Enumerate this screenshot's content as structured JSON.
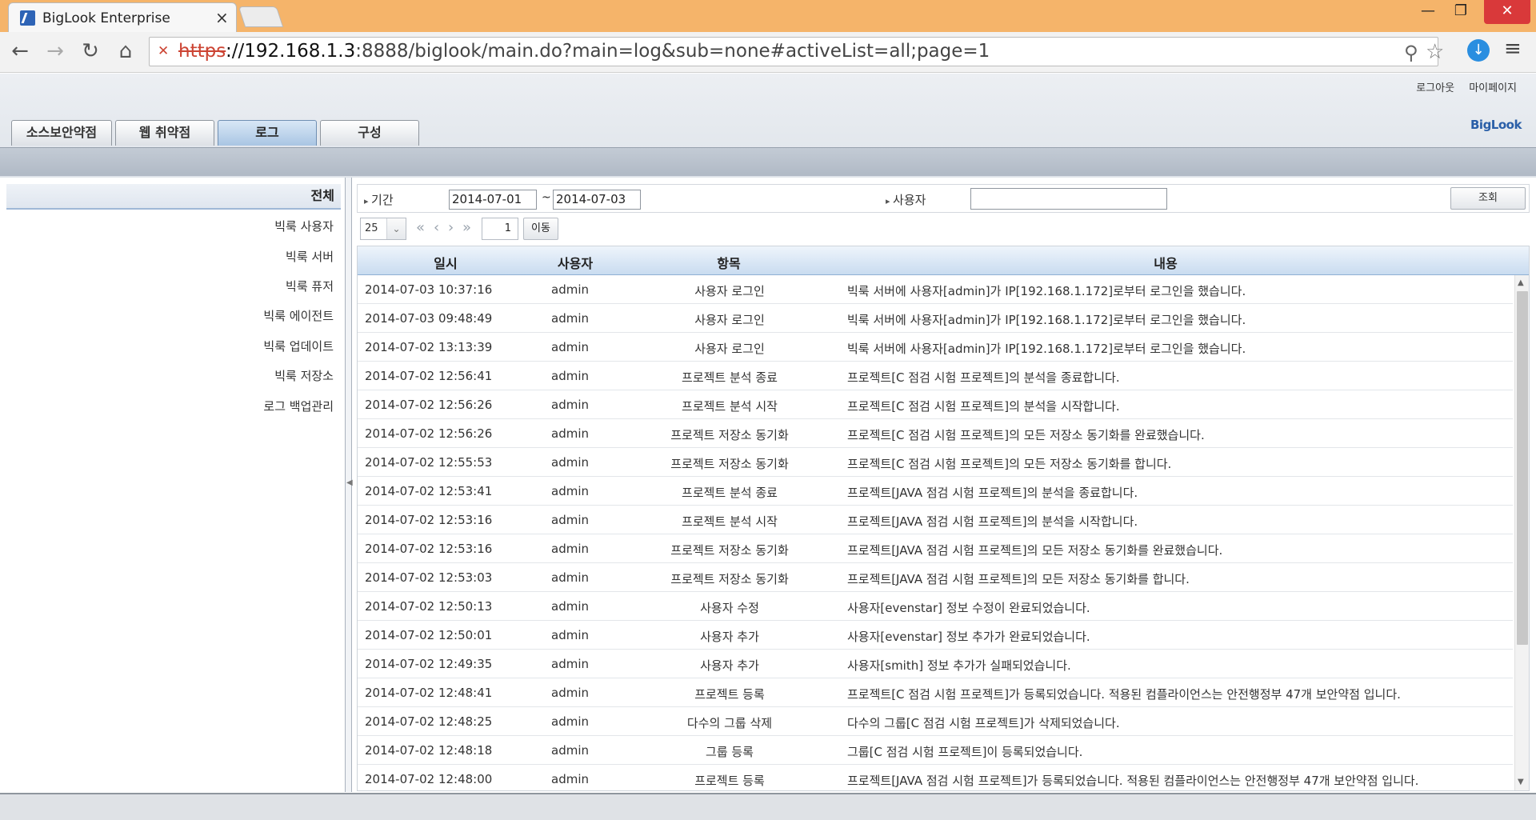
{
  "browser": {
    "tab_title": "BigLook Enterprise",
    "tab_close": "×",
    "url_scheme": "https",
    "url_host": "://192.168.1.3",
    "url_rest": ":8888/biglook/main.do?main=log&sub=none#activeList=all;page=1",
    "window_min": "—",
    "window_max": "❐",
    "window_close": "✕"
  },
  "header": {
    "logout": "로그아웃",
    "mypage": "마이페이지",
    "brand": "BigLook",
    "tabs": [
      {
        "label": "소스보안약점",
        "active": false
      },
      {
        "label": "웹 취약점",
        "active": false
      },
      {
        "label": "로그",
        "active": true
      },
      {
        "label": "구성",
        "active": false
      }
    ]
  },
  "sidebar": {
    "title": "전체",
    "items": [
      "빅룩 사용자",
      "빅룩 서버",
      "빅룩 퓨저",
      "빅룩 에이전트",
      "빅룩 업데이트",
      "빅룩 저장소",
      "로그 백업관리"
    ]
  },
  "filter": {
    "period_label": "기간",
    "date_from": "2014-07-01",
    "tilde": "~",
    "date_to": "2014-07-03",
    "user_label": "사용자",
    "user_value": "",
    "search_button": "조회"
  },
  "pager": {
    "page_size": "25",
    "page": "1",
    "go_button": "이동"
  },
  "grid": {
    "columns": [
      "일시",
      "사용자",
      "항목",
      "내용"
    ],
    "rows": [
      {
        "date": "2014-07-03 10:37:16",
        "user": "admin",
        "item": "사용자 로그인",
        "msg": "빅룩 서버에 사용자[admin]가 IP[192.168.1.172]로부터 로그인을 했습니다."
      },
      {
        "date": "2014-07-03 09:48:49",
        "user": "admin",
        "item": "사용자 로그인",
        "msg": "빅룩 서버에 사용자[admin]가 IP[192.168.1.172]로부터 로그인을 했습니다."
      },
      {
        "date": "2014-07-02 13:13:39",
        "user": "admin",
        "item": "사용자 로그인",
        "msg": "빅룩 서버에 사용자[admin]가 IP[192.168.1.172]로부터 로그인을 했습니다."
      },
      {
        "date": "2014-07-02 12:56:41",
        "user": "admin",
        "item": "프로젝트 분석 종료",
        "msg": "프로젝트[C 점검 시험 프로젝트]의 분석을 종료합니다."
      },
      {
        "date": "2014-07-02 12:56:26",
        "user": "admin",
        "item": "프로젝트 분석 시작",
        "msg": "프로젝트[C 점검 시험 프로젝트]의 분석을 시작합니다."
      },
      {
        "date": "2014-07-02 12:56:26",
        "user": "admin",
        "item": "프로젝트 저장소 동기화",
        "msg": "프로젝트[C 점검 시험 프로젝트]의 모든 저장소 동기화를 완료했습니다."
      },
      {
        "date": "2014-07-02 12:55:53",
        "user": "admin",
        "item": "프로젝트 저장소 동기화",
        "msg": "프로젝트[C 점검 시험 프로젝트]의 모든 저장소 동기화를 합니다."
      },
      {
        "date": "2014-07-02 12:53:41",
        "user": "admin",
        "item": "프로젝트 분석 종료",
        "msg": "프로젝트[JAVA 점검 시험 프로젝트]의 분석을 종료합니다."
      },
      {
        "date": "2014-07-02 12:53:16",
        "user": "admin",
        "item": "프로젝트 분석 시작",
        "msg": "프로젝트[JAVA 점검 시험 프로젝트]의 분석을 시작합니다."
      },
      {
        "date": "2014-07-02 12:53:16",
        "user": "admin",
        "item": "프로젝트 저장소 동기화",
        "msg": "프로젝트[JAVA 점검 시험 프로젝트]의 모든 저장소 동기화를 완료했습니다."
      },
      {
        "date": "2014-07-02 12:53:03",
        "user": "admin",
        "item": "프로젝트 저장소 동기화",
        "msg": "프로젝트[JAVA 점검 시험 프로젝트]의 모든 저장소 동기화를 합니다."
      },
      {
        "date": "2014-07-02 12:50:13",
        "user": "admin",
        "item": "사용자 수정",
        "msg": "사용자[evenstar] 정보 수정이 완료되었습니다."
      },
      {
        "date": "2014-07-02 12:50:01",
        "user": "admin",
        "item": "사용자 추가",
        "msg": "사용자[evenstar] 정보 추가가 완료되었습니다."
      },
      {
        "date": "2014-07-02 12:49:35",
        "user": "admin",
        "item": "사용자 추가",
        "msg": "사용자[smith] 정보 추가가 실패되었습니다."
      },
      {
        "date": "2014-07-02 12:48:41",
        "user": "admin",
        "item": "프로젝트 등록",
        "msg": "프로젝트[C 점검 시험 프로젝트]가 등록되었습니다. 적용된 컴플라이언스는 안전행정부 47개 보안약점 입니다."
      },
      {
        "date": "2014-07-02 12:48:25",
        "user": "admin",
        "item": "다수의 그룹 삭제",
        "msg": "다수의 그룹[C 점검 시험 프로젝트]가 삭제되었습니다."
      },
      {
        "date": "2014-07-02 12:48:18",
        "user": "admin",
        "item": "그룹 등록",
        "msg": "그룹[C 점검 시험 프로젝트]이 등록되었습니다."
      },
      {
        "date": "2014-07-02 12:48:00",
        "user": "admin",
        "item": "프로젝트 등록",
        "msg": "프로젝트[JAVA 점검 시험 프로젝트]가 등록되었습니다. 적용된 컴플라이언스는 안전행정부 47개 보안약점 입니다."
      }
    ]
  }
}
